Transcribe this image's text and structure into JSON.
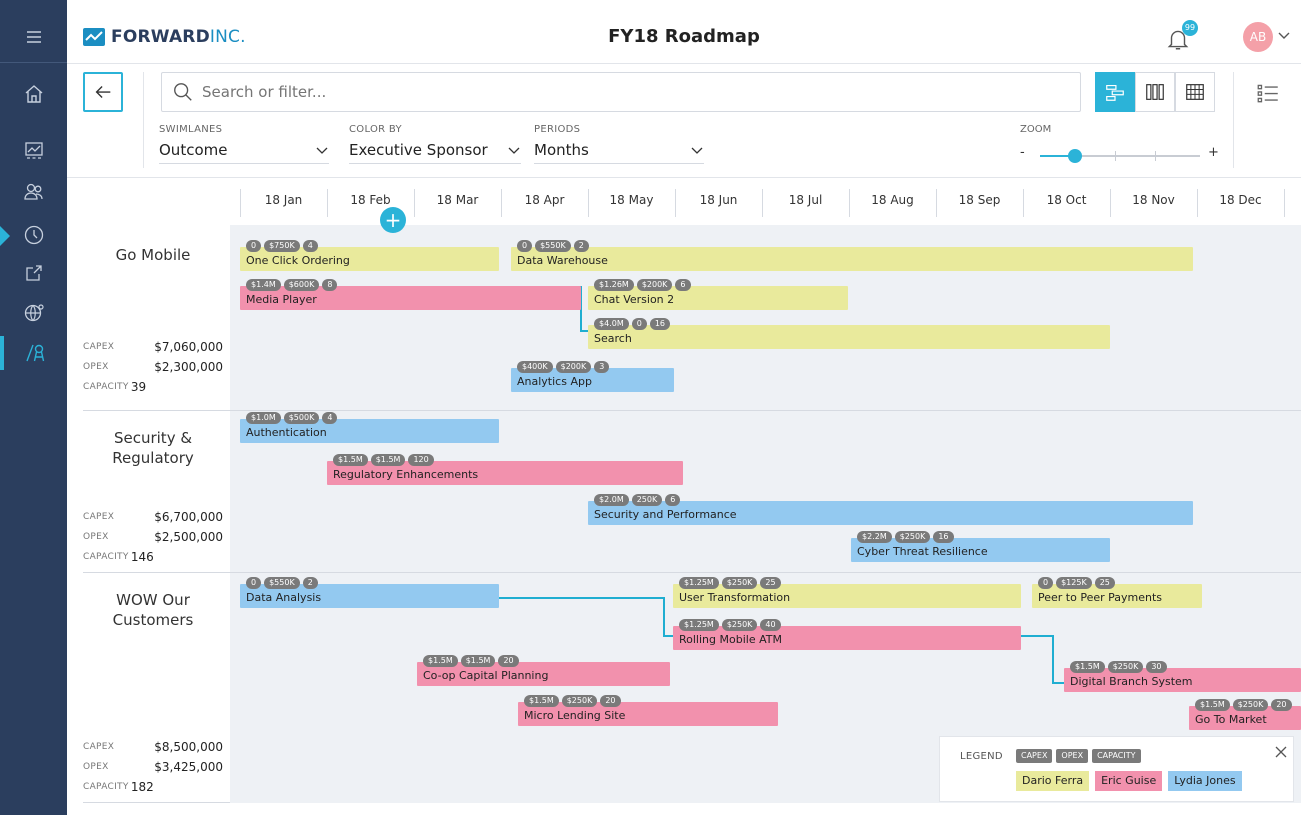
{
  "header": {
    "logo_bold": "FORWARD",
    "logo_light": "INC.",
    "title": "FY18 Roadmap",
    "notification_count": "99",
    "avatar_initials": "AB"
  },
  "rail": {
    "items": [
      {
        "icon": "hamburger-icon"
      },
      {
        "icon": "home-icon"
      },
      {
        "icon": "chart-icon"
      },
      {
        "icon": "team-icon"
      },
      {
        "icon": "clock-icon"
      },
      {
        "icon": "export-icon"
      },
      {
        "icon": "globe-icon"
      },
      {
        "icon": "roadmap-icon",
        "active": true
      }
    ]
  },
  "toolbar": {
    "search_placeholder": "Search or filter...",
    "swimlanes_label": "SWIMLANES",
    "swimlanes_value": "Outcome",
    "color_by_label": "COLOR BY",
    "color_by_value": "Executive Sponsor",
    "periods_label": "PERIODS",
    "periods_value": "Months",
    "zoom_label": "ZOOM",
    "zoom_minus": "-",
    "zoom_plus": "+",
    "zoom_level": 0.22
  },
  "months": [
    "18 Jan",
    "18 Feb",
    "18 Mar",
    "18 Apr",
    "18 May",
    "18 Jun",
    "18 Jul",
    "18 Aug",
    "18 Sep",
    "18 Oct",
    "18 Nov",
    "18 Dec"
  ],
  "lanes": [
    {
      "title": "Go Mobile",
      "capex_label": "CAPEX",
      "capex": "$7,060,000",
      "opex_label": "OPEX",
      "opex": "$2,300,000",
      "capacity_label": "CAPACITY",
      "capacity": "39"
    },
    {
      "title": "Security & Regulatory",
      "capex_label": "CAPEX",
      "capex": "$6,700,000",
      "opex_label": "OPEX",
      "opex": "$2,500,000",
      "capacity_label": "CAPACITY",
      "capacity": "146"
    },
    {
      "title": "WOW Our Customers",
      "capex_label": "CAPEX",
      "capex": "$8,500,000",
      "opex_label": "OPEX",
      "opex": "$3,425,000",
      "capacity_label": "CAPACITY",
      "capacity": "182"
    }
  ],
  "bars": [
    {
      "label": "One Click Ordering",
      "capex": "0",
      "opex": "$750K",
      "capacity": "4",
      "sponsor": "Dario Ferra"
    },
    {
      "label": "Data Warehouse",
      "capex": "0",
      "opex": "$550K",
      "capacity": "2",
      "sponsor": "Dario Ferra"
    },
    {
      "label": "Media Player",
      "capex": "$1.4M",
      "opex": "$600K",
      "capacity": "8",
      "sponsor": "Eric Guise"
    },
    {
      "label": "Chat Version 2",
      "capex": "$1.26M",
      "opex": "$200K",
      "capacity": "6",
      "sponsor": "Dario Ferra"
    },
    {
      "label": "Search",
      "capex": "$4.0M",
      "opex": "0",
      "capacity": "16",
      "sponsor": "Dario Ferra"
    },
    {
      "label": "Analytics App",
      "capex": "$400K",
      "opex": "$200K",
      "capacity": "3",
      "sponsor": "Lydia Jones"
    },
    {
      "label": "Authentication",
      "capex": "$1.0M",
      "opex": "$500K",
      "capacity": "4",
      "sponsor": "Lydia Jones"
    },
    {
      "label": "Regulatory Enhancements",
      "capex": "$1.5M",
      "opex": "$1.5M",
      "capacity": "120",
      "sponsor": "Eric Guise"
    },
    {
      "label": "Security and Performance",
      "capex": "$2.0M",
      "opex": "250K",
      "capacity": "6",
      "sponsor": "Lydia Jones"
    },
    {
      "label": "Cyber Threat Resilience",
      "capex": "$2.2M",
      "opex": "$250K",
      "capacity": "16",
      "sponsor": "Lydia Jones"
    },
    {
      "label": "Data Analysis",
      "capex": "0",
      "opex": "$550K",
      "capacity": "2",
      "sponsor": "Lydia Jones"
    },
    {
      "label": "User Transformation",
      "capex": "$1.25M",
      "opex": "$250K",
      "capacity": "25",
      "sponsor": "Dario Ferra"
    },
    {
      "label": "Peer to Peer Payments",
      "capex": "0",
      "opex": "$125K",
      "capacity": "25",
      "sponsor": "Dario Ferra"
    },
    {
      "label": "Rolling Mobile ATM",
      "capex": "$1.25M",
      "opex": "$250K",
      "capacity": "40",
      "sponsor": "Eric Guise"
    },
    {
      "label": "Co-op Capital Planning",
      "capex": "$1.5M",
      "opex": "$1.5M",
      "capacity": "20",
      "sponsor": "Eric Guise"
    },
    {
      "label": "Digital Branch System",
      "capex": "$1.5M",
      "opex": "$250K",
      "capacity": "30",
      "sponsor": "Eric Guise"
    },
    {
      "label": "Micro Lending Site",
      "capex": "$1.5M",
      "opex": "$250K",
      "capacity": "20",
      "sponsor": "Eric Guise"
    },
    {
      "label": "Go To Market",
      "capex": "$1.5M",
      "opex": "$250K",
      "capacity": "20",
      "sponsor": "Eric Guise"
    }
  ],
  "legend": {
    "title": "LEGEND",
    "badge_capex": "CAPEX",
    "badge_opex": "OPEX",
    "badge_capacity": "CAPACITY",
    "sponsors": [
      {
        "name": "Dario Ferra",
        "color": "#e9ea9c"
      },
      {
        "name": "Eric Guise",
        "color": "#f291ad"
      },
      {
        "name": "Lydia Jones",
        "color": "#93c9f0"
      }
    ]
  },
  "colors": {
    "rail_bg": "#2b3e5e",
    "accent": "#2bb3d8",
    "grid_bg": "#eef1f5"
  }
}
